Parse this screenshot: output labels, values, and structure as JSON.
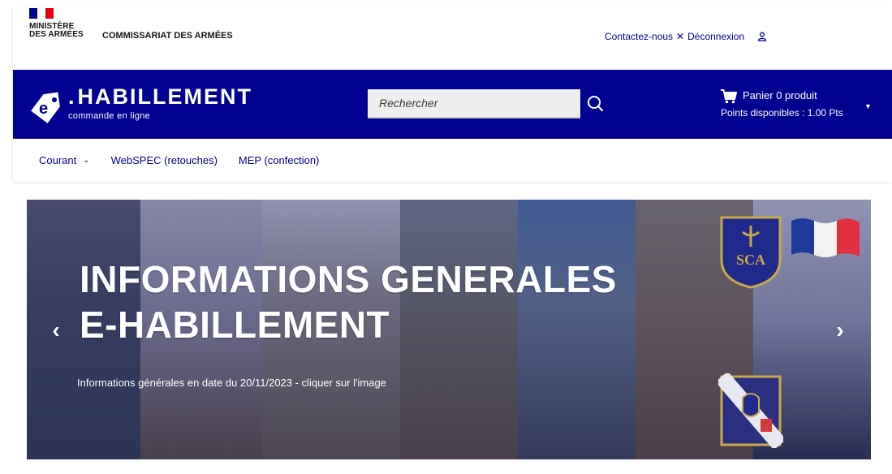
{
  "header": {
    "ministry_line1": "MINISTÈRE",
    "ministry_line2": "DES ARMÉES",
    "commissariat": "COMMISSARIAT DES ARMÉES",
    "contact_link": "Contactez-nous",
    "logout_link": "Déconnexion",
    "flag_colors": [
      "#000091",
      "#ffffff",
      "#e1000f"
    ]
  },
  "brand": {
    "title": "HABILLEMENT",
    "subtitle": "commande en ligne",
    "band_color": "#000091"
  },
  "search": {
    "placeholder": "Rechercher"
  },
  "cart": {
    "label": "Panier 0 produit",
    "points": "Points disponibles : 1.00 Pts"
  },
  "nav": {
    "items": [
      {
        "label": "Courant",
        "has_dropdown": true
      },
      {
        "label": "WebSPEC (retouches)",
        "has_dropdown": false
      },
      {
        "label": "MEP (confection)",
        "has_dropdown": false
      }
    ]
  },
  "banner": {
    "title_line1": "INFORMATIONS GENERALES",
    "title_line2": "E-HABILLEMENT",
    "caption": "Informations générales en date du 20/11/2023 - cliquer sur l'image",
    "badge_text": "SCA"
  }
}
